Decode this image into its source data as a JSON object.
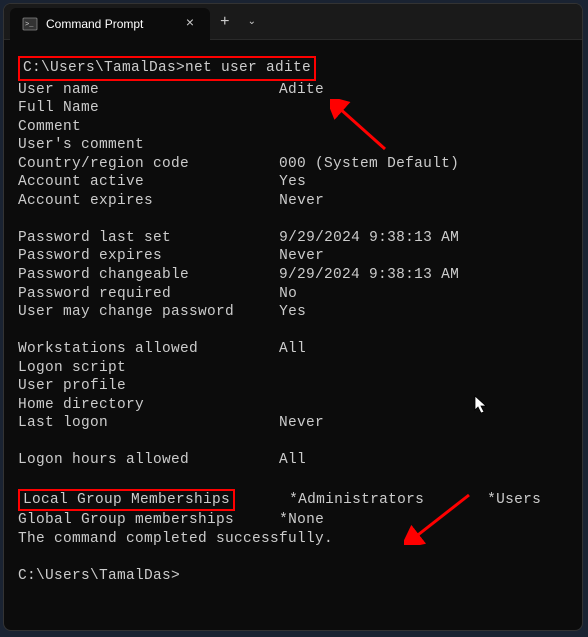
{
  "titlebar": {
    "tab_title": "Command Prompt",
    "close_glyph": "×",
    "add_glyph": "+",
    "dropdown_glyph": "⌄"
  },
  "terminal": {
    "prompt1": "C:\\Users\\TamalDas>net user adite",
    "rows": [
      {
        "label": "User name",
        "value": "Adite"
      },
      {
        "label": "Full Name",
        "value": ""
      },
      {
        "label": "Comment",
        "value": ""
      },
      {
        "label": "User's comment",
        "value": ""
      },
      {
        "label": "Country/region code",
        "value": "000 (System Default)"
      },
      {
        "label": "Account active",
        "value": "Yes"
      },
      {
        "label": "Account expires",
        "value": "Never"
      }
    ],
    "rows2": [
      {
        "label": "Password last set",
        "value": "9/29/2024 9:38:13 AM"
      },
      {
        "label": "Password expires",
        "value": "Never"
      },
      {
        "label": "Password changeable",
        "value": "9/29/2024 9:38:13 AM"
      },
      {
        "label": "Password required",
        "value": "No"
      },
      {
        "label": "User may change password",
        "value": "Yes"
      }
    ],
    "rows3": [
      {
        "label": "Workstations allowed",
        "value": "All"
      },
      {
        "label": "Logon script",
        "value": ""
      },
      {
        "label": "User profile",
        "value": ""
      },
      {
        "label": "Home directory",
        "value": ""
      },
      {
        "label": "Last logon",
        "value": "Never"
      }
    ],
    "rows4": [
      {
        "label": "Logon hours allowed",
        "value": "All"
      }
    ],
    "lgm_label": "Local Group Memberships",
    "lgm_value": "*Administrators       *Users",
    "ggm_label": "Global Group memberships",
    "ggm_value": "*None",
    "completed": "The command completed successfully.",
    "prompt2": "C:\\Users\\TamalDas>"
  }
}
